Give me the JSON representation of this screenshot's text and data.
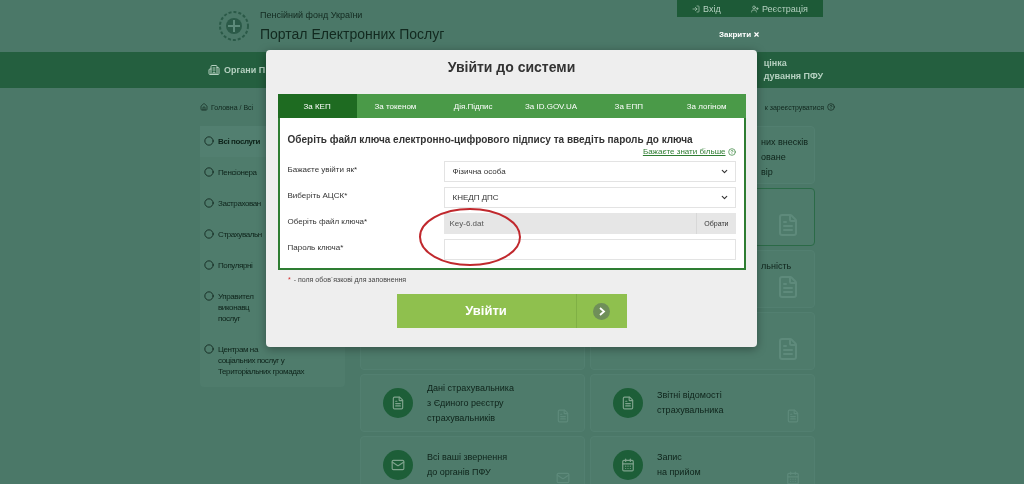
{
  "header": {
    "org": "Пенсійний фонд України",
    "title": "Портал Електронних Послуг",
    "login": "Вхід",
    "register": "Реєстрація",
    "close": "Закрити"
  },
  "nav": {
    "left": "Органи П",
    "right": [
      "цінка",
      "дування ПФУ"
    ]
  },
  "breadcrumb": {
    "path": "Головна / Всі",
    "register_hint": "к зареєструватися"
  },
  "sidebar": [
    {
      "lines": [
        "Всі послуги"
      ],
      "selected": true
    },
    {
      "lines": [
        "Пенсіонера"
      ],
      "selected": false
    },
    {
      "lines": [
        "Застрахован"
      ],
      "selected": false
    },
    {
      "lines": [
        "Страхувальн"
      ],
      "selected": false
    },
    {
      "lines": [
        "Популярні"
      ],
      "selected": false
    },
    {
      "lines": [
        "Управител",
        "виконавц",
        "послуг"
      ],
      "selected": false
    },
    {
      "lines": [
        "Центрам на",
        "соціальних послуг у",
        "Територіальних громадах"
      ],
      "selected": false
    }
  ],
  "side_cards": [
    {
      "lines": [
        "них внесків",
        "оване",
        "вір"
      ],
      "highlighted": false
    },
    {
      "highlighted": true
    },
    {
      "lines": [
        "льність"
      ],
      "highlighted": false
    }
  ],
  "service_cards": [
    {
      "lines": [
        "Дані страхувальника",
        "з Єдиного реєстру",
        "страхувальників"
      ]
    },
    {
      "lines": [
        "Звітні відомості",
        "страхувальника"
      ]
    },
    {
      "lines": [
        "Всі ваші звернення",
        "до органів ПФУ"
      ]
    },
    {
      "lines": [
        "Запис",
        "на прийом"
      ]
    }
  ],
  "modal": {
    "title": "Увійти до системи",
    "tabs": [
      {
        "label": "За КЕП",
        "selected": true
      },
      {
        "label": "За токеном",
        "selected": false
      },
      {
        "label": "Дія.Підпис",
        "selected": false
      },
      {
        "label": "За ID.GOV.UA",
        "selected": false
      },
      {
        "label": "За ЕПП",
        "selected": false
      },
      {
        "label": "За логіном",
        "selected": false
      }
    ],
    "heading": "Оберіть файл ключа електронно-цифрового підпису та введіть пароль до ключа",
    "more_link": "Бажаєте знати більше",
    "fields": [
      {
        "kind": "select",
        "label": "Бажаєте увійти як*",
        "value": "Фізична особа"
      },
      {
        "kind": "select",
        "label": "Виберіть АЦСК*",
        "value": "КНЕДП ДПС"
      },
      {
        "kind": "file",
        "label": "Оберіть файл ключа*",
        "value": "Key-6.dat",
        "button": "Обрати"
      },
      {
        "kind": "password",
        "label": "Пароль ключа*"
      }
    ],
    "required_mark": "*",
    "required_note": "- поля обов`язкові для заповнення",
    "submit": "Увійти"
  }
}
